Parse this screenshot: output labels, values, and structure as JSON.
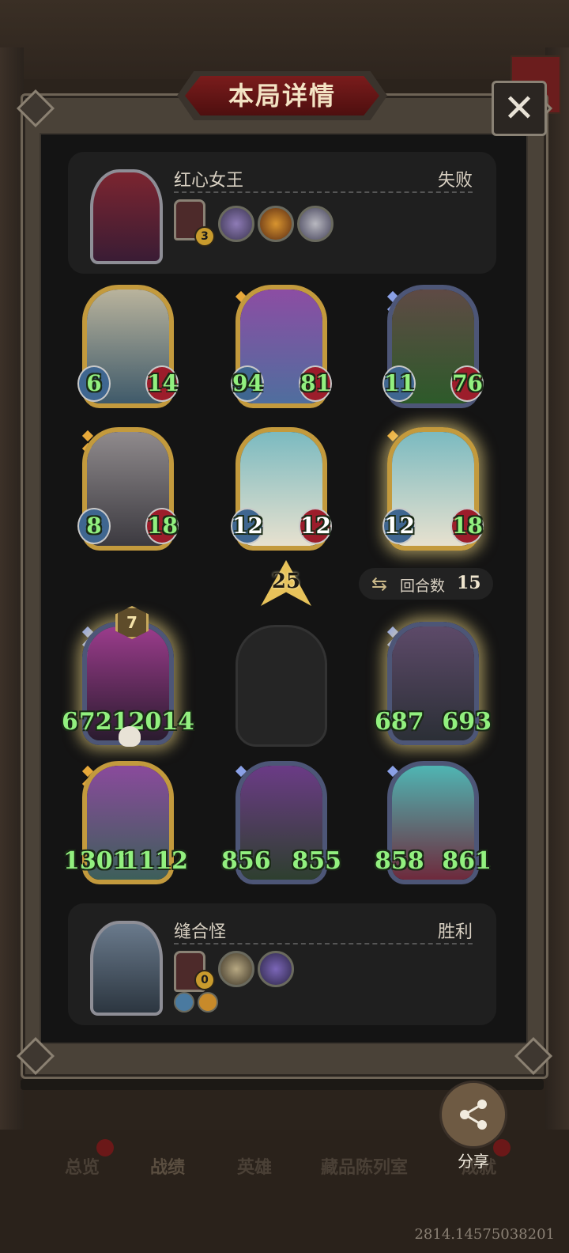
{
  "title": "本局详情",
  "top_player": {
    "name": "红心女王",
    "result": "失败",
    "badge": "3"
  },
  "bottom_player": {
    "name": "缝合怪",
    "result": "胜利",
    "badge": "0"
  },
  "cards_top": [
    {
      "atk": "6",
      "hp": "14"
    },
    {
      "atk": "94",
      "hp": "81"
    },
    {
      "atk": "11",
      "hp": "76"
    },
    {
      "atk": "8",
      "hp": "18"
    },
    {
      "atk": "12",
      "hp": "12"
    },
    {
      "atk": "12",
      "hp": "18"
    }
  ],
  "cards_bottom": [
    {
      "atk": "6",
      "hp": "7212014",
      "star": "7"
    },
    {
      "atk": "687",
      "hp": "693"
    },
    {
      "atk": "1301",
      "hp": "1112"
    },
    {
      "atk": "856",
      "hp": "855"
    },
    {
      "atk": "858",
      "hp": "861"
    }
  ],
  "level": "25",
  "rounds": {
    "label": "回合数",
    "value": "15"
  },
  "nav": [
    "总览",
    "战绩",
    "英雄",
    "藏品陈列室",
    "成就"
  ],
  "share_label": "分享",
  "version": "2814.14575038201"
}
